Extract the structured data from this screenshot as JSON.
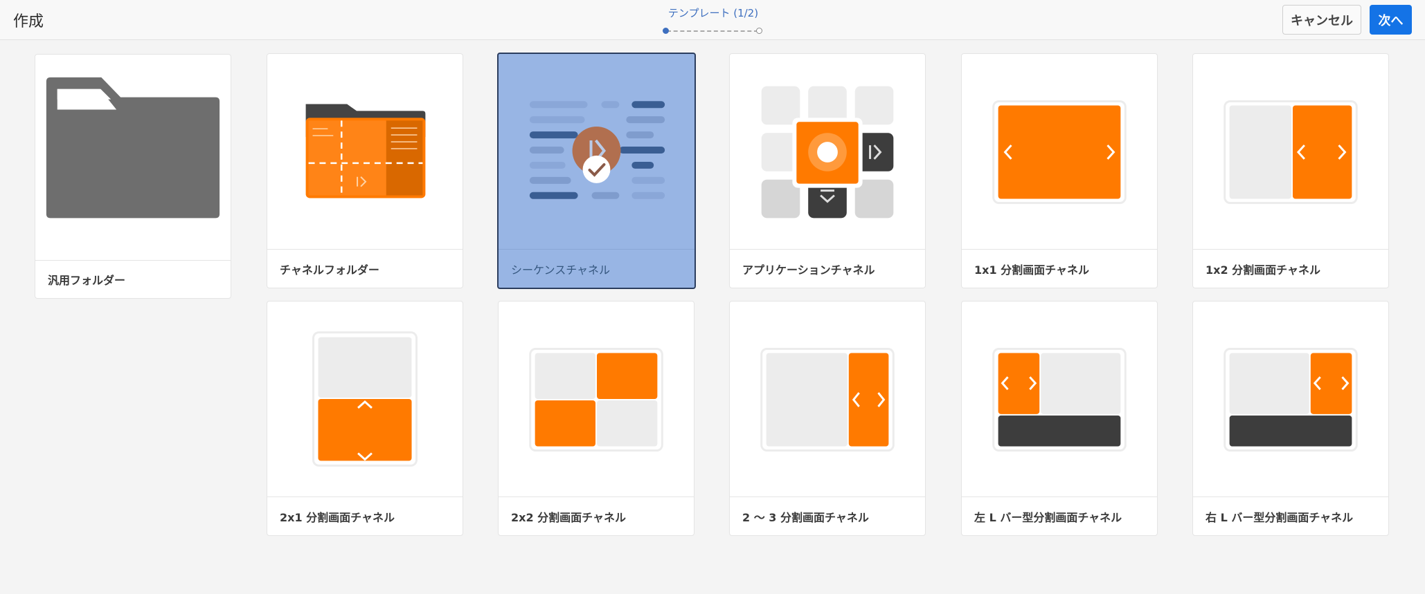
{
  "header": {
    "title": "作成",
    "step_label": "テンプレート (1/2)",
    "cancel_label": "キャンセル",
    "next_label": "次へ"
  },
  "colors": {
    "accent_orange": "#ff7a00",
    "primary_blue": "#1473e6",
    "selected_bg": "#98b5e4",
    "dark_gray": "#3d3d3d",
    "light_gray": "#ececec"
  },
  "templates": [
    {
      "label": "汎用フォルダー",
      "icon": "folder-icon",
      "selected": false
    },
    {
      "label": "チャネルフォルダー",
      "icon": "channel-folder-icon",
      "selected": false
    },
    {
      "label": "シーケンスチャネル",
      "icon": "sequence-channel-icon",
      "selected": true
    },
    {
      "label": "アプリケーションチャネル",
      "icon": "application-channel-icon",
      "selected": false
    },
    {
      "label": "1x1 分割画面チャネル",
      "icon": "split-1x1-icon",
      "selected": false
    },
    {
      "label": "1x2 分割画面チャネル",
      "icon": "split-1x2-icon",
      "selected": false
    },
    {
      "label": "2x1 分割画面チャネル",
      "icon": "split-2x1-icon",
      "selected": false
    },
    {
      "label": "2x2 分割画面チャネル",
      "icon": "split-2x2-icon",
      "selected": false
    },
    {
      "label": "2 〜 3 分割画面チャネル",
      "icon": "split-2to3-icon",
      "selected": false
    },
    {
      "label": "左 L バー型分割画面チャネル",
      "icon": "left-lbar-split-icon",
      "selected": false
    },
    {
      "label": "右 L バー型分割画面チャネル",
      "icon": "right-lbar-split-icon",
      "selected": false
    }
  ]
}
